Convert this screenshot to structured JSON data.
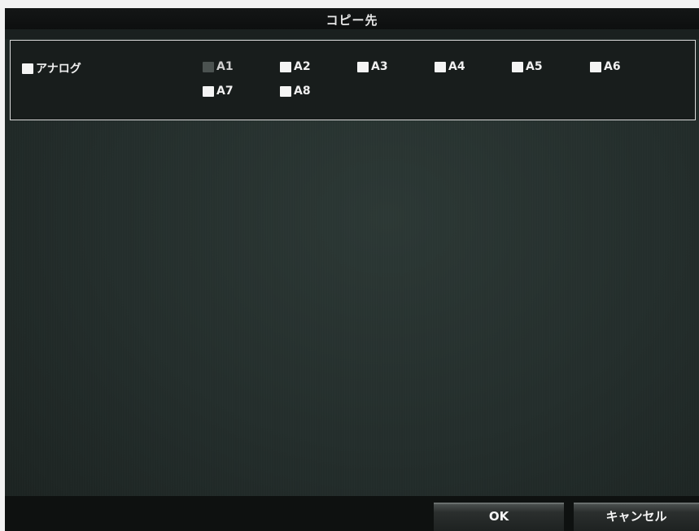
{
  "dialog": {
    "title": "コピー先"
  },
  "analog": {
    "group_label": "アナログ",
    "channels": [
      {
        "label": "A1",
        "checked": false,
        "enabled": false
      },
      {
        "label": "A2",
        "checked": false,
        "enabled": true
      },
      {
        "label": "A3",
        "checked": false,
        "enabled": true
      },
      {
        "label": "A4",
        "checked": false,
        "enabled": true
      },
      {
        "label": "A5",
        "checked": false,
        "enabled": true
      },
      {
        "label": "A6",
        "checked": false,
        "enabled": true
      },
      {
        "label": "A7",
        "checked": false,
        "enabled": true
      },
      {
        "label": "A8",
        "checked": false,
        "enabled": true
      }
    ]
  },
  "footer": {
    "ok_label": "OK",
    "cancel_label": "キャンセル"
  },
  "colors": {
    "panel_border": "#d9d9d9",
    "checkbox": "#f4f4f4",
    "checkbox_disabled": "#4b5250",
    "background": "#232d2b"
  }
}
